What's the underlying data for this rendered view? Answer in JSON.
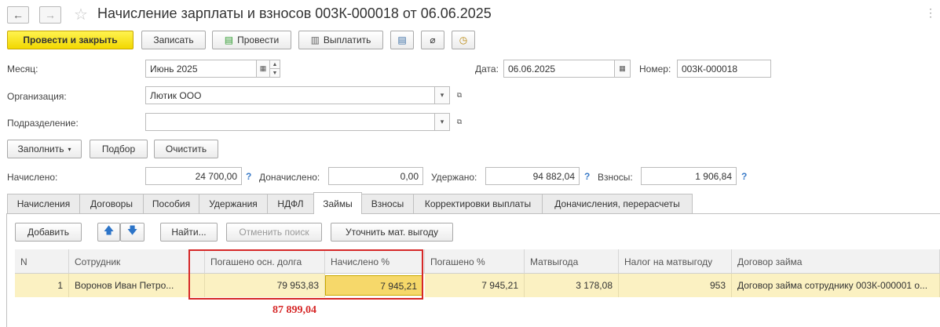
{
  "window": {
    "title": "Начисление зарплаты и взносов 003К-000018 от 06.06.2025",
    "back_icon": "←",
    "forward_icon": "→",
    "star_icon": "☆",
    "more_icon": "⋮"
  },
  "toolbar": {
    "post_close": "Провести и закрыть",
    "save": "Записать",
    "post": "Провести",
    "pay": "Выплатить"
  },
  "fields": {
    "month_label": "Месяц:",
    "month_value": "Июнь 2025",
    "date_label": "Дата:",
    "date_value": "06.06.2025",
    "number_label": "Номер:",
    "number_value": "003К-000018",
    "org_label": "Организация:",
    "org_value": "Лютик ООО",
    "dept_label": "Подразделение:",
    "dept_value": ""
  },
  "actions": {
    "fill": "Заполнить",
    "pick": "Подбор",
    "clear": "Очистить"
  },
  "totals": {
    "accrued_label": "Начислено:",
    "accrued_value": "24 700,00",
    "extra_label": "Доначислено:",
    "extra_value": "0,00",
    "withheld_label": "Удержано:",
    "withheld_value": "94 882,04",
    "contrib_label": "Взносы:",
    "contrib_value": "1 906,84",
    "help": "?"
  },
  "tabs": [
    "Начисления",
    "Договоры",
    "Пособия",
    "Удержания",
    "НДФЛ",
    "Займы",
    "Взносы",
    "Корректировки выплаты",
    "Доначисления, перерасчеты"
  ],
  "active_tab": "Займы",
  "grid_toolbar": {
    "add": "Добавить",
    "up_icon": "🡅",
    "down_icon": "🡇",
    "find": "Найти...",
    "cancel_search": "Отменить поиск",
    "refine": "Уточнить мат. выгоду"
  },
  "table": {
    "columns": [
      "N",
      "Сотрудник",
      "Погашено осн. долга",
      "Начислено %",
      "Погашено %",
      "Матвыгода",
      "Налог на матвыгоду",
      "Договор займа"
    ],
    "rows": [
      {
        "n": "1",
        "employee": "Воронов Иван Петро...",
        "principal_paid": "79 953,83",
        "interest_accrued": "7 945,21",
        "interest_paid": "7 945,21",
        "benefit": "3 178,08",
        "benefit_tax": "953",
        "contract": "Договор займа сотруднику 003К-000001 о..."
      }
    ]
  },
  "annotation": "87 899,04",
  "colors": {
    "primary_button": "#f2d800",
    "selected_row": "#fbf1c2",
    "highlight_border": "#d62828"
  }
}
